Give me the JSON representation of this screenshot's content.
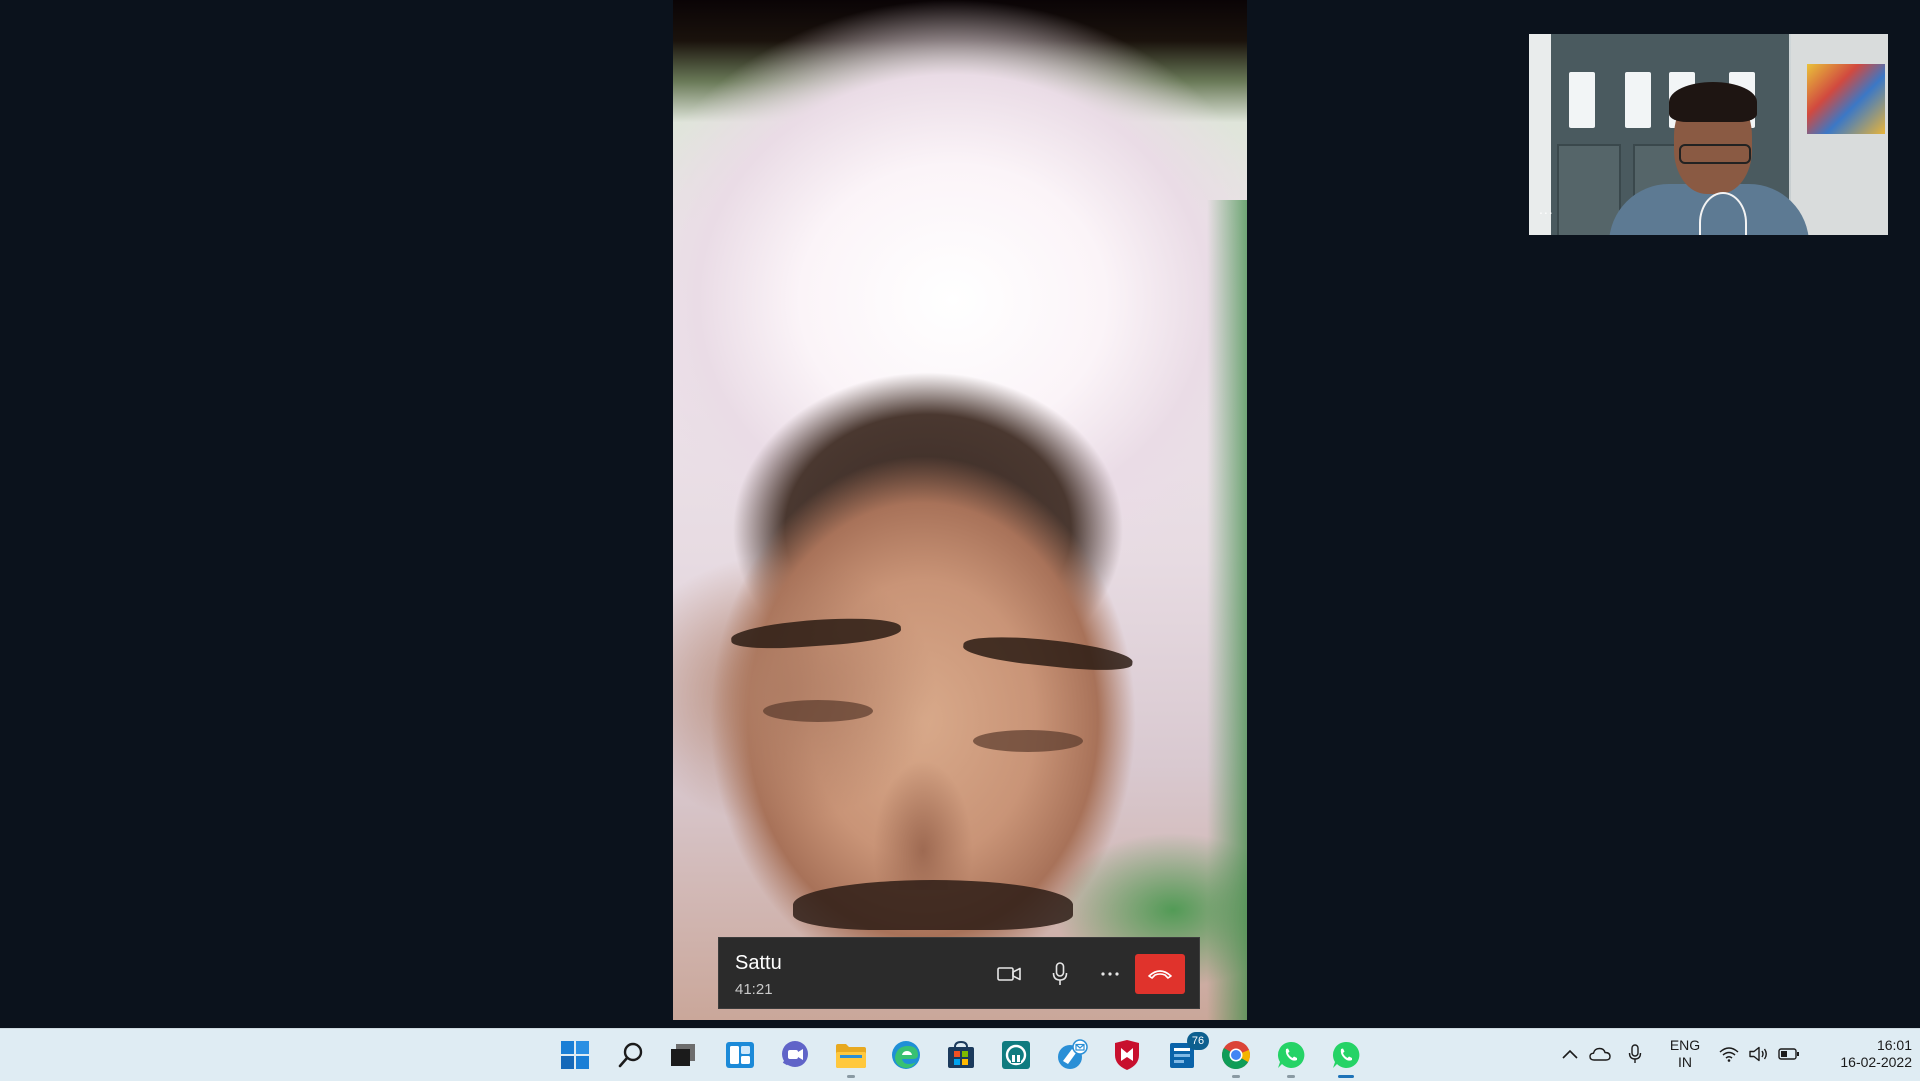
{
  "call": {
    "caller_name": "Sattu",
    "duration": "41:21",
    "controls": [
      {
        "name": "video",
        "icon": "video-camera-icon"
      },
      {
        "name": "microphone",
        "icon": "microphone-icon"
      },
      {
        "name": "more",
        "icon": "more-icon"
      },
      {
        "name": "end-call",
        "icon": "hang-up-icon",
        "color": "#e0332c"
      }
    ],
    "self_preview_menu": "..."
  },
  "taskbar": {
    "apps": [
      {
        "name": "start",
        "icon": "windows-start-icon"
      },
      {
        "name": "search",
        "icon": "search-icon"
      },
      {
        "name": "task-view",
        "icon": "task-view-icon"
      },
      {
        "name": "widgets",
        "icon": "widgets-icon"
      },
      {
        "name": "teams-chat",
        "icon": "teams-chat-icon"
      },
      {
        "name": "file-explorer",
        "icon": "folder-icon"
      },
      {
        "name": "edge",
        "icon": "edge-icon"
      },
      {
        "name": "microsoft-store",
        "icon": "store-icon"
      },
      {
        "name": "app",
        "icon": "app-icon"
      },
      {
        "name": "email",
        "icon": "email-icon"
      },
      {
        "name": "mcafee",
        "icon": "mcafee-icon"
      },
      {
        "name": "mail-app",
        "icon": "mail-app-icon",
        "badge": "76"
      },
      {
        "name": "chrome",
        "icon": "chrome-icon"
      },
      {
        "name": "whatsapp",
        "icon": "whatsapp-icon"
      },
      {
        "name": "whatsapp-active",
        "icon": "whatsapp-icon"
      }
    ],
    "tray": {
      "language_line1": "ENG",
      "language_line2": "IN",
      "time": "16:01",
      "date": "16-02-2022"
    }
  },
  "colors": {
    "background": "#0b121c",
    "call_bar": "#2b2b2b",
    "end_call": "#e0332c",
    "taskbar": "#dfecf3",
    "accent": "#1e73b8"
  }
}
